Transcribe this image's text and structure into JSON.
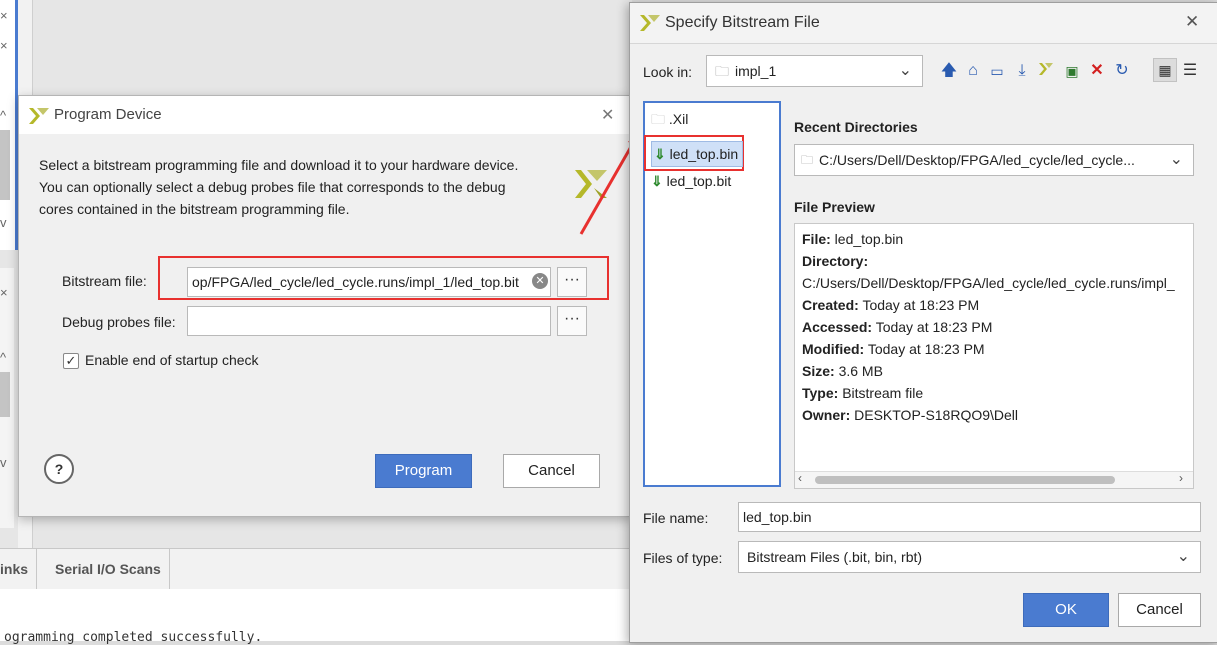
{
  "background": {
    "tabs": [
      "inks",
      "Serial I/O Scans"
    ],
    "console_text": "ogramming completed successfully."
  },
  "program_device": {
    "title": "Program Device",
    "description": [
      "Select a bitstream programming file and download it to your hardware device.",
      "You can optionally select a debug probes file that corresponds to the debug",
      "cores contained in the bitstream programming file."
    ],
    "bitstream_label": "Bitstream file:",
    "bitstream_value": "op/FPGA/led_cycle/led_cycle.runs/impl_1/led_top.bit",
    "debug_label": "Debug probes file:",
    "debug_value": "",
    "browse_label": "···",
    "startup_check_label": "Enable end of startup check",
    "startup_check_checked": true,
    "help_label": "?",
    "program_label": "Program",
    "cancel_label": "Cancel"
  },
  "specify_bitstream": {
    "title": "Specify Bitstream File",
    "look_in_label": "Look in:",
    "look_in_value": "impl_1",
    "toolbar_icons": [
      "up-folder-icon",
      "home-icon",
      "desktop-icon",
      "download-icon",
      "vivado-icon",
      "new-folder-icon",
      "delete-icon",
      "refresh-icon",
      "thumbnail-view-icon",
      "list-view-icon"
    ],
    "files": [
      {
        "name": ".Xil",
        "type": "folder",
        "selected": false
      },
      {
        "name": "led_top.bin",
        "type": "bitstream",
        "selected": true
      },
      {
        "name": "led_top.bit",
        "type": "bitstream",
        "selected": false
      }
    ],
    "recent_dirs_label": "Recent Directories",
    "recent_dir_value": "C:/Users/Dell/Desktop/FPGA/led_cycle/led_cycle...",
    "file_preview_label": "File Preview",
    "preview": {
      "file_key": "File:",
      "file_val": "led_top.bin",
      "dir_key": "Directory:",
      "dir_val": "C:/Users/Dell/Desktop/FPGA/led_cycle/led_cycle.runs/impl_",
      "created_key": "Created:",
      "created_val": "Today at 18:23 PM",
      "accessed_key": "Accessed:",
      "accessed_val": "Today at 18:23 PM",
      "modified_key": "Modified:",
      "modified_val": "Today at 18:23 PM",
      "size_key": "Size:",
      "size_val": "3.6 MB",
      "type_key": "Type:",
      "type_val": "Bitstream file",
      "owner_key": "Owner:",
      "owner_val": "DESKTOP-S18RQO9\\Dell"
    },
    "file_name_label": "File name:",
    "file_name_value": "led_top.bin",
    "files_of_type_label": "Files of type:",
    "files_of_type_value": "Bitstream Files (.bit, bin, rbt)",
    "ok_label": "OK",
    "cancel_label": "Cancel"
  },
  "colors": {
    "accent": "#4a7bd0",
    "highlight": "#e8312f",
    "vivado_logo": "#b5b82a"
  }
}
